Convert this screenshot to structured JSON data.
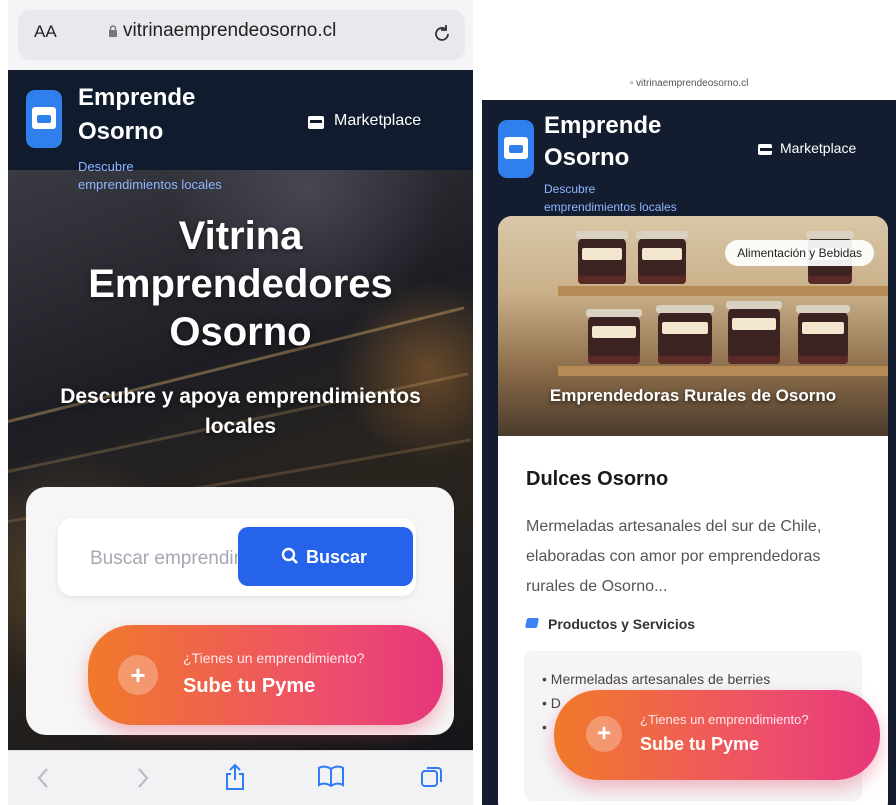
{
  "left": {
    "browser": {
      "aa_label": "AA",
      "url": "vitrinaemprendeosorno.cl",
      "lock_icon": "lock-icon",
      "reload_icon": "reload-icon"
    },
    "header": {
      "brand_line1": "Emprende",
      "brand_line2": "Osorno",
      "subtitle_line1": "Descubre",
      "subtitle_line2": "emprendimientos locales",
      "marketplace_label": "Marketplace"
    },
    "hero": {
      "title_line1": "Vitrina",
      "title_line2": "Emprendedores",
      "title_line3": "Osorno",
      "subtitle_line1": "Descubre y apoya emprendimientos",
      "subtitle_line2": "locales"
    },
    "search": {
      "placeholder": "Buscar emprendimientos",
      "button_label": "Buscar"
    },
    "cta": {
      "question": "¿Tienes un emprendimiento?",
      "title": "Sube tu Pyme"
    },
    "toolbar": {
      "icons": [
        "back-icon",
        "forward-icon",
        "share-icon",
        "bookmarks-icon",
        "tabs-icon"
      ]
    }
  },
  "right": {
    "browser": {
      "url": "vitrinaemprendeosorno.cl"
    },
    "header": {
      "brand_line1": "Emprende",
      "brand_line2": "Osorno",
      "subtitle_line1": "Descubre",
      "subtitle_line2": "emprendimientos locales",
      "marketplace_label": "Marketplace"
    },
    "card": {
      "category_badge": "Alimentación y Bebidas",
      "image_caption": "Emprendedoras Rurales de Osorno",
      "title": "Dulces Osorno",
      "description": "Mermeladas artesanales del sur de Chile, elaboradas con amor por emprendedoras rurales de Osorno...",
      "tag": "Productos y Servicios",
      "list_items": [
        "• Mermeladas artesanales de berries",
        "• D",
        "•"
      ]
    },
    "cta": {
      "question": "¿Tienes un emprendimiento?",
      "title": "Sube tu Pyme"
    }
  },
  "colors": {
    "header_bg": "#101c2e",
    "brand_blue": "#2f80ed",
    "button_blue": "#2563eb",
    "cta_start": "#f07a2a",
    "cta_end": "#e5367a"
  }
}
